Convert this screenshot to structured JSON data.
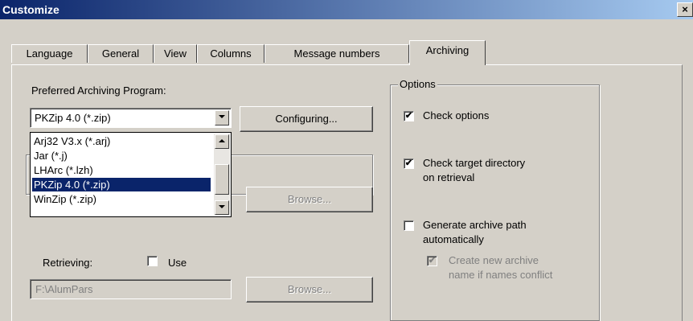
{
  "window": {
    "title": "Customize",
    "close_glyph": "×"
  },
  "tabs": [
    {
      "label": "Language"
    },
    {
      "label": "General"
    },
    {
      "label": "View"
    },
    {
      "label": "Columns"
    },
    {
      "label": "Message numbers"
    },
    {
      "label": "Archiving",
      "active": true
    }
  ],
  "archiving": {
    "program_label": "Preferred Archiving Program:",
    "program_selected": "PKZip 4.0 (*.zip)",
    "configure_button": "Configuring...",
    "dropdown_options": [
      "Arj32 V3.x (*.arj)",
      "Jar (*.j)",
      "LHArc (*.lzh)",
      "PKZip 4.0 (*.zip)",
      "WinZip (*.zip)"
    ],
    "dropdown_selected_index": 3,
    "browse_button_1": "Browse...",
    "retrieving_label": "Retrieving:",
    "use_label": "Use",
    "use_checked": false,
    "retrieving_path": "F:\\AlumPars",
    "browse_button_2": "Browse..."
  },
  "options": {
    "title": "Options",
    "check_options": {
      "label": "Check options",
      "checked": true
    },
    "check_target": {
      "label_line1": "Check target directory",
      "label_line2": "on retrieval",
      "checked": true
    },
    "generate_path": {
      "label_line1": "Generate archive path",
      "label_line2": "automatically",
      "checked": false
    },
    "create_new": {
      "label_line1": "Create new archive",
      "label_line2": "name if names conflict",
      "checked": true,
      "disabled": true
    }
  },
  "colors": {
    "titlebar_start": "#0a246a",
    "titlebar_end": "#a6caf0",
    "face": "#d4d0c8",
    "selection": "#0a246a"
  },
  "icons": {
    "check": "check-mark",
    "dropdown": "chevron-down-icon",
    "scroll_up": "chevron-up-icon"
  }
}
